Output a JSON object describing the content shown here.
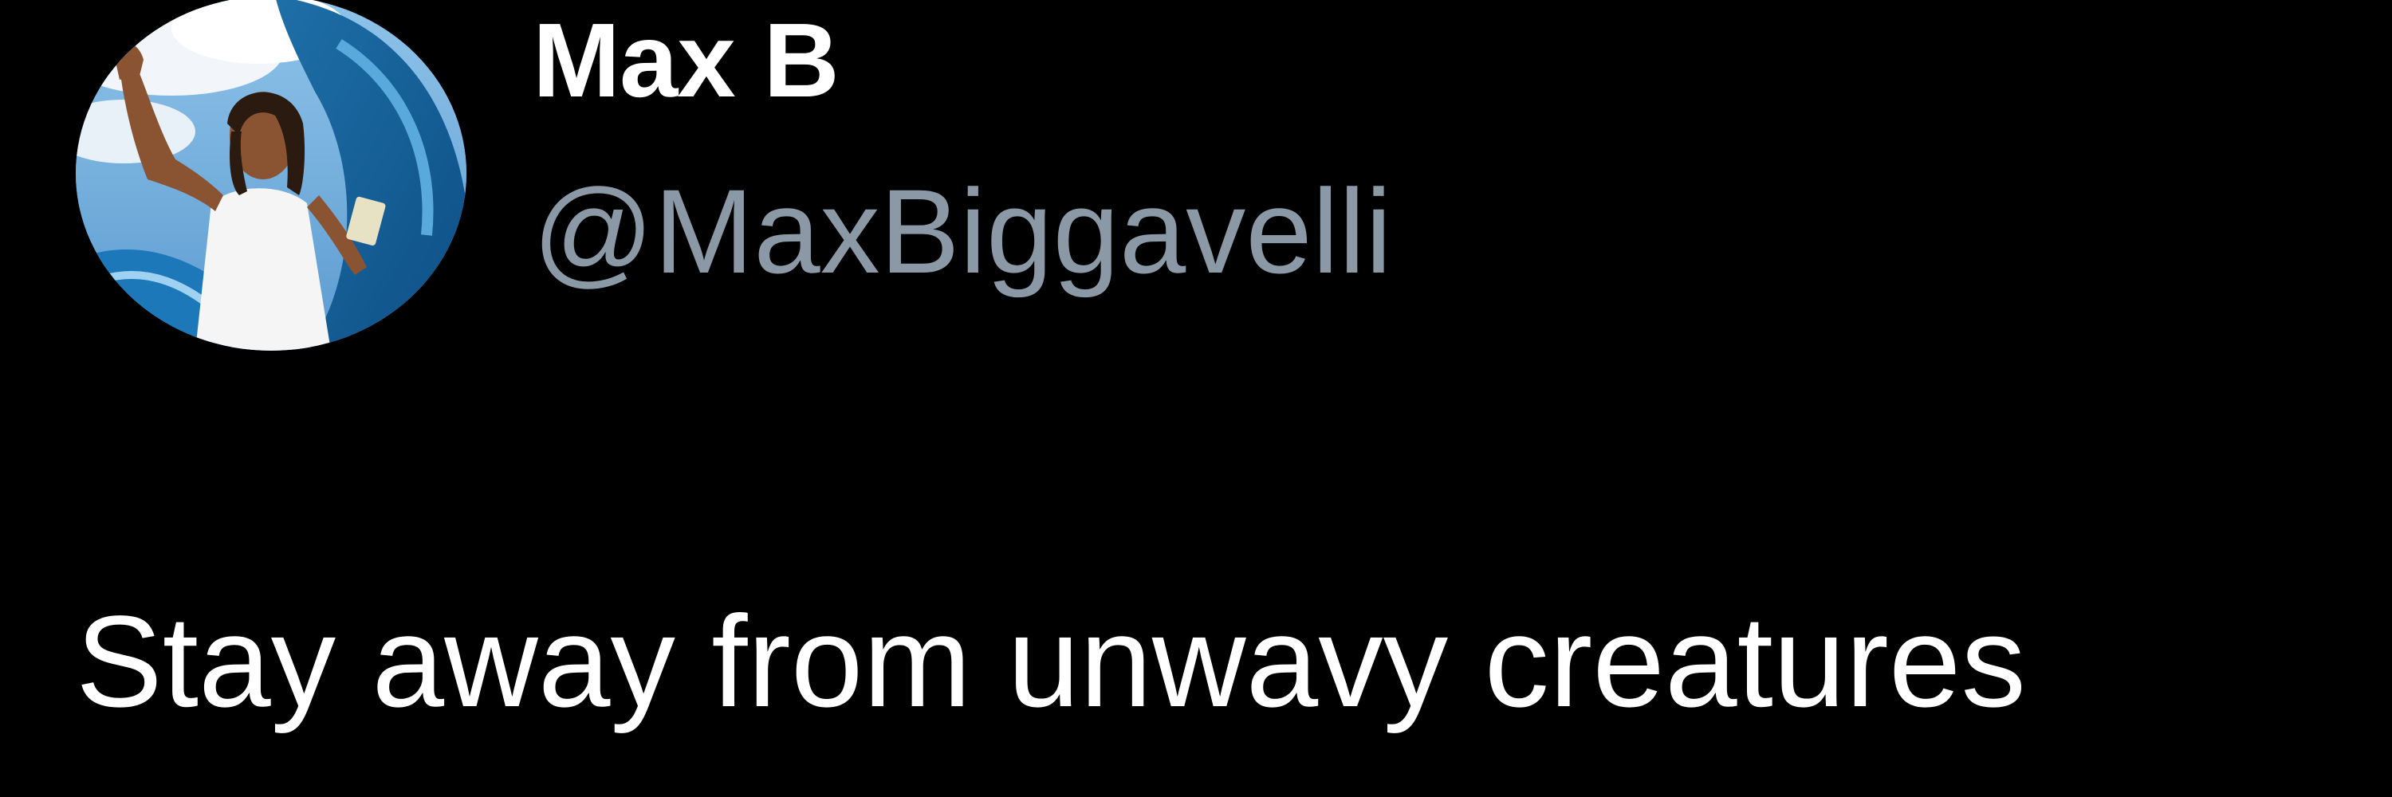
{
  "tweet": {
    "author": {
      "display_name": "Max B",
      "handle": "@MaxBiggavelli",
      "avatar": "profile-photo"
    },
    "text": "Stay away from unwavy creatures"
  },
  "colors": {
    "background": "#000000",
    "name": "#ffffff",
    "handle": "#8b98a5",
    "body": "#ffffff"
  }
}
